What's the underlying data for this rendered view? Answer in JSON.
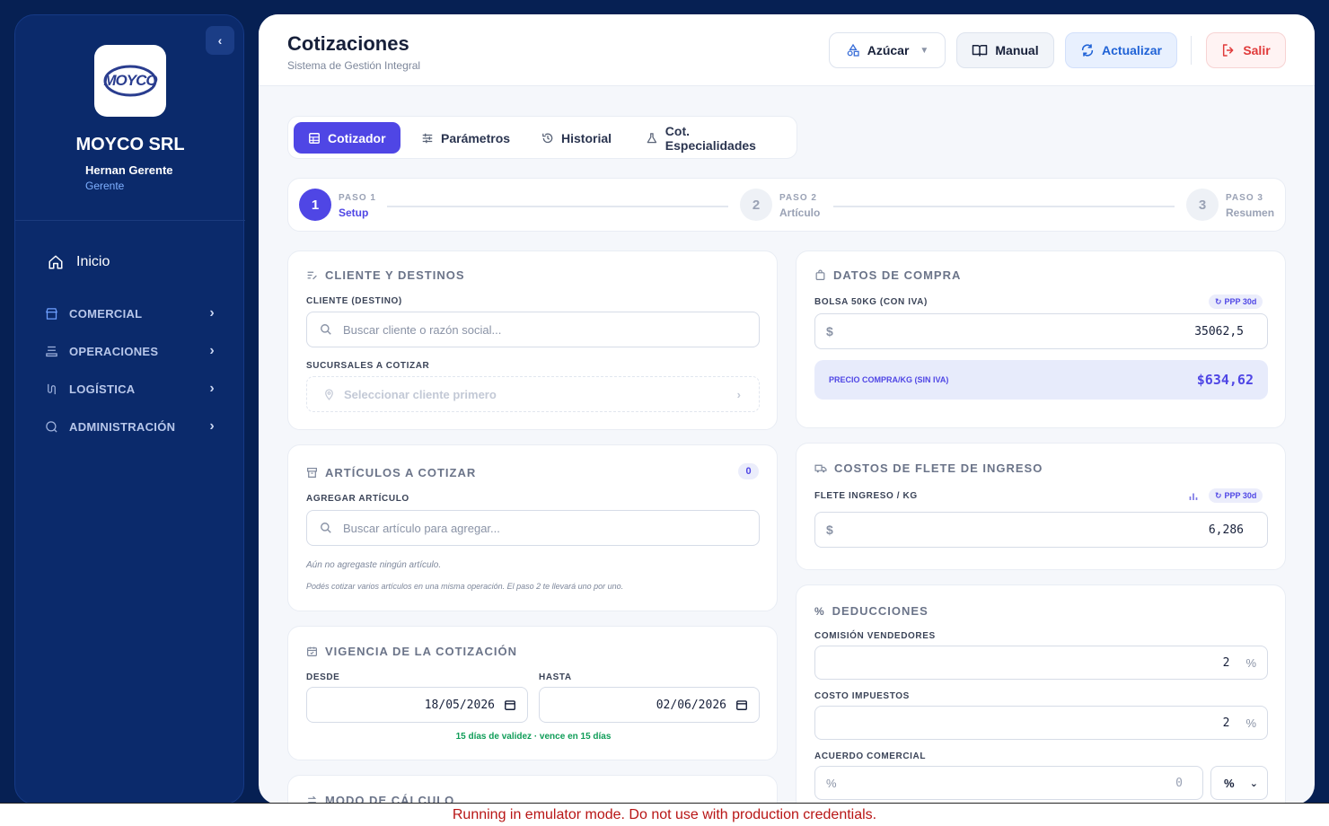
{
  "sidebar": {
    "company": "MOYCO SRL",
    "logo_text": "MOYCO",
    "user_name": "Hernan Gerente",
    "user_role": "Gerente",
    "home_label": "Inicio",
    "sections": [
      {
        "label": "COMERCIAL",
        "icon": "store-icon"
      },
      {
        "label": "OPERACIONES",
        "icon": "operations-icon"
      },
      {
        "label": "LOGÍSTICA",
        "icon": "route-icon"
      },
      {
        "label": "ADMINISTRACIÓN",
        "icon": "admin-icon"
      }
    ]
  },
  "header": {
    "title": "Cotizaciones",
    "subtitle": "Sistema de Gestión Integral",
    "product_label": "Azúcar",
    "manual_label": "Manual",
    "refresh_label": "Actualizar",
    "logout_label": "Salir"
  },
  "tabs": [
    {
      "label": "Cotizador",
      "active": true
    },
    {
      "label": "Parámetros",
      "active": false
    },
    {
      "label": "Historial",
      "active": false
    },
    {
      "label": "Cot. Especialidades",
      "active": false
    }
  ],
  "stepper": {
    "steps": [
      {
        "number": "1",
        "kicker": "PASO 1",
        "name": "Setup",
        "active": true
      },
      {
        "number": "2",
        "kicker": "PASO 2",
        "name": "Artículo",
        "active": false
      },
      {
        "number": "3",
        "kicker": "PASO 3",
        "name": "Resumen",
        "active": false
      }
    ]
  },
  "client_card": {
    "title": "CLIENTE Y DESTINOS",
    "client_label": "CLIENTE (DESTINO)",
    "client_placeholder": "Buscar cliente o razón social...",
    "branches_label": "SUCURSALES A COTIZAR",
    "branches_placeholder": "Seleccionar cliente primero"
  },
  "articles_card": {
    "title": "ARTÍCULOS A COTIZAR",
    "count": "0",
    "add_label": "AGREGAR ARTÍCULO",
    "add_placeholder": "Buscar artículo para agregar...",
    "empty_text": "Aún no agregaste ningún artículo.",
    "hint_text": "Podés cotizar varios artículos en una misma operación. El paso 2 te llevará uno por uno."
  },
  "validity_card": {
    "title": "VIGENCIA DE LA COTIZACIÓN",
    "from_label": "DESDE",
    "from_value": "18/05/2026",
    "to_label": "HASTA",
    "to_value": "02/06/2026",
    "validity_note": "15 días de validez · vence en 15 días"
  },
  "calc_mode_card": {
    "title": "MODO DE CÁLCULO"
  },
  "purchase_card": {
    "title": "DATOS DE COMPRA",
    "bag_label": "BOLSA 50KG (CON IVA)",
    "ppp_badge": "PPP 30d",
    "currency": "$",
    "bag_value": "35062,5",
    "price_label": "PRECIO COMPRA/KG (SIN IVA)",
    "price_value": "$634,62"
  },
  "freight_card": {
    "title": "COSTOS DE FLETE DE INGRESO",
    "freight_label": "FLETE INGRESO / KG",
    "ppp_badge": "PPP 30d",
    "currency": "$",
    "freight_value": "6,286"
  },
  "deductions_card": {
    "title": "DEDUCCIONES",
    "commission_label": "COMISIÓN VENDEDORES",
    "commission_value": "2",
    "taxes_label": "COSTO IMPUESTOS",
    "taxes_value": "2",
    "agreement_label": "ACUERDO COMERCIAL",
    "agreement_prefix": "%",
    "agreement_value": "0",
    "unit_symbol": "%",
    "agreement_unit": "%"
  },
  "emulator_banner": "Running in emulator mode. Do not use with production credentials.",
  "colors": {
    "accent": "#4f46e5",
    "sidebar_bg": "#0b2a6b",
    "page_bg": "#062053",
    "success": "#0f9d58",
    "danger": "#e03a3a"
  }
}
